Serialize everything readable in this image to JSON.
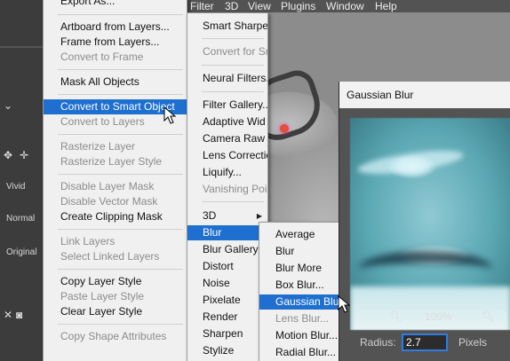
{
  "menubar": {
    "items": [
      "Filter",
      "3D",
      "View",
      "Plugins",
      "Window",
      "Help"
    ],
    "active": "Filter"
  },
  "left_panel": {
    "labels": [
      "Vivid",
      "Normal",
      "Original"
    ]
  },
  "layer_menu": {
    "items": [
      {
        "label": "Export As...",
        "disabled": false
      },
      {
        "label": "Artboard from Layers...",
        "disabled": false
      },
      {
        "label": "Frame from Layers...",
        "disabled": false
      },
      {
        "label": "Convert to Frame",
        "disabled": true
      },
      {
        "label": "Mask All Objects",
        "disabled": false
      },
      {
        "label": "Convert to Smart Object",
        "disabled": false,
        "highlighted": true
      },
      {
        "label": "Convert to Layers",
        "disabled": true
      },
      {
        "label": "Rasterize Layer",
        "disabled": true
      },
      {
        "label": "Rasterize Layer Style",
        "disabled": true
      },
      {
        "label": "Disable Layer Mask",
        "disabled": true
      },
      {
        "label": "Disable Vector Mask",
        "disabled": true
      },
      {
        "label": "Create Clipping Mask",
        "disabled": false
      },
      {
        "label": "Link Layers",
        "disabled": true
      },
      {
        "label": "Select Linked Layers",
        "disabled": true
      },
      {
        "label": "Copy Layer Style",
        "disabled": false
      },
      {
        "label": "Paste Layer Style",
        "disabled": true
      },
      {
        "label": "Clear Layer Style",
        "disabled": false
      },
      {
        "label": "Copy Shape Attributes",
        "disabled": true
      }
    ]
  },
  "filter_menu": {
    "items": [
      {
        "label": "Smart Sharpen",
        "disabled": false
      },
      {
        "label": "Convert for Sm",
        "disabled": true
      },
      {
        "label": "Neural Filters...",
        "disabled": false
      },
      {
        "label": "Filter Gallery...",
        "disabled": false
      },
      {
        "label": "Adaptive Wid",
        "disabled": false
      },
      {
        "label": "Camera Raw F",
        "disabled": false
      },
      {
        "label": "Lens Correctio",
        "disabled": false
      },
      {
        "label": "Liquify...",
        "disabled": false
      },
      {
        "label": "Vanishing Poi",
        "disabled": true
      },
      {
        "label": "3D",
        "disabled": false
      },
      {
        "label": "Blur",
        "disabled": false,
        "highlighted": true
      },
      {
        "label": "Blur Gallery",
        "disabled": false
      },
      {
        "label": "Distort",
        "disabled": false
      },
      {
        "label": "Noise",
        "disabled": false
      },
      {
        "label": "Pixelate",
        "disabled": false
      },
      {
        "label": "Render",
        "disabled": false
      },
      {
        "label": "Sharpen",
        "disabled": false
      },
      {
        "label": "Stylize",
        "disabled": false
      }
    ]
  },
  "blur_submenu": {
    "items": [
      {
        "label": "Average",
        "disabled": false
      },
      {
        "label": "Blur",
        "disabled": false
      },
      {
        "label": "Blur More",
        "disabled": false
      },
      {
        "label": "Box Blur...",
        "disabled": false
      },
      {
        "label": "Gaussian Blur...",
        "disabled": false,
        "highlighted": true
      },
      {
        "label": "Lens Blur...",
        "disabled": true
      },
      {
        "label": "Motion Blur...",
        "disabled": false
      },
      {
        "label": "Radial Blur...",
        "disabled": false
      }
    ]
  },
  "dialog": {
    "title": "Gaussian Blur",
    "zoom_level": "100%",
    "radius_label": "Radius:",
    "radius_value": "2.7",
    "radius_unit": "Pixels"
  },
  "colors": {
    "highlight": "#1e6fcf",
    "menu_bg": "#f0f0f0",
    "dialog_bg": "#535353",
    "field_border": "#2f7de0"
  }
}
